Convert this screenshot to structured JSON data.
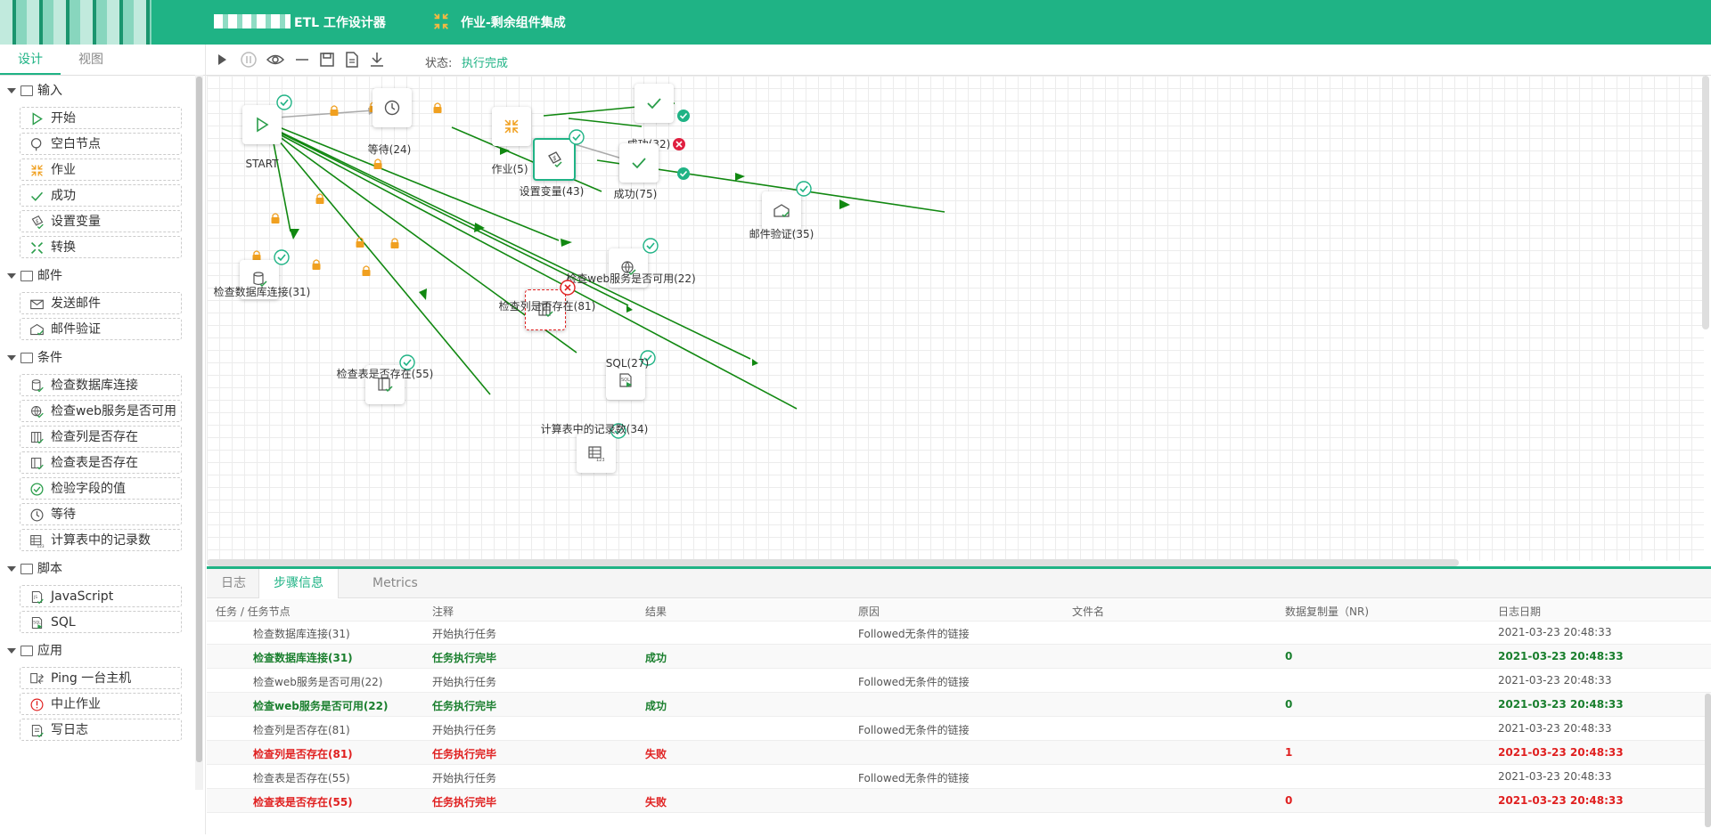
{
  "header": {
    "app_title": "ETL 工作设计器",
    "job_title": "作业-剩余组件集成"
  },
  "left": {
    "tabs": [
      "设计",
      "视图"
    ],
    "groups": [
      {
        "label": "输入",
        "items": [
          {
            "label": "开始",
            "icon": "play-icon"
          },
          {
            "label": "空白节点",
            "icon": "blank-node-icon"
          },
          {
            "label": "作业",
            "icon": "job-icon"
          },
          {
            "label": "成功",
            "icon": "check-icon"
          },
          {
            "label": "设置变量",
            "icon": "set-variable-icon"
          },
          {
            "label": "转换",
            "icon": "transform-icon"
          }
        ]
      },
      {
        "label": "邮件",
        "items": [
          {
            "label": "发送邮件",
            "icon": "mail-icon"
          },
          {
            "label": "邮件验证",
            "icon": "mail-verify-icon"
          }
        ]
      },
      {
        "label": "条件",
        "items": [
          {
            "label": "检查数据库连接",
            "icon": "database-icon"
          },
          {
            "label": "检查web服务是否可用",
            "icon": "web-service-icon"
          },
          {
            "label": "检查列是否存在",
            "icon": "column-icon"
          },
          {
            "label": "检查表是否存在",
            "icon": "table-icon"
          },
          {
            "label": "检验字段的值",
            "icon": "check-circle-icon"
          },
          {
            "label": "等待",
            "icon": "clock-icon"
          },
          {
            "label": "计算表中的记录数",
            "icon": "count-icon"
          }
        ]
      },
      {
        "label": "脚本",
        "items": [
          {
            "label": "JavaScript",
            "icon": "script-icon"
          },
          {
            "label": "SQL",
            "icon": "sql-icon"
          }
        ]
      },
      {
        "label": "应用",
        "items": [
          {
            "label": "Ping 一台主机",
            "icon": "ping-icon"
          },
          {
            "label": "中止作业",
            "icon": "abort-icon"
          },
          {
            "label": "写日志",
            "icon": "log-icon"
          }
        ]
      }
    ]
  },
  "toolbar": {
    "status_label": "状态:",
    "status_value": "执行完成"
  },
  "canvas": {
    "nodes": [
      {
        "id": "start",
        "label": "START",
        "icon": "play-icon",
        "state": "ok"
      },
      {
        "id": "wait",
        "label": "等待(24)",
        "icon": "clock-icon",
        "state": "none"
      },
      {
        "id": "job",
        "label": "作业(5)",
        "icon": "job-icon",
        "state": "none"
      },
      {
        "id": "succ32",
        "label": "成功(32)",
        "icon": "check-icon",
        "state": "none"
      },
      {
        "id": "succ75",
        "label": "成功(75)",
        "icon": "check-icon",
        "state": "none"
      },
      {
        "id": "setvar",
        "label": "设置变量(43)",
        "icon": "set-variable-icon",
        "state": "ok"
      },
      {
        "id": "mail",
        "label": "邮件验证(35)",
        "icon": "mail-verify-icon",
        "state": "ok"
      },
      {
        "id": "web",
        "label": "检查web服务是否可用(22)",
        "icon": "web-service-icon",
        "state": "ok"
      },
      {
        "id": "db",
        "label": "检查数据库连接(31)",
        "icon": "database-icon",
        "state": "ok"
      },
      {
        "id": "col",
        "label": "检查列是否存在(81)",
        "icon": "column-icon",
        "state": "fail"
      },
      {
        "id": "sql",
        "label": "SQL(27)",
        "icon": "sql-icon",
        "state": "ok"
      },
      {
        "id": "tbl",
        "label": "检查表是否存在(55)",
        "icon": "table-icon",
        "state": "ok"
      },
      {
        "id": "cnt",
        "label": "计算表中的记录数(34)",
        "icon": "count-icon",
        "state": "ok"
      }
    ]
  },
  "bottom": {
    "tabs": [
      "日志",
      "步骤信息",
      "Metrics"
    ],
    "columns": [
      "任务 / 任务节点",
      "注释",
      "结果",
      "原因",
      "文件名",
      "数据复制量（NR)",
      "日志日期"
    ],
    "rows": [
      {
        "style": "plain",
        "node": "检查数据库连接(31)",
        "note": "开始执行任务",
        "result": "",
        "reason": "Followed无条件的链接",
        "file": "",
        "nr": "",
        "date": "2021-03-23 20:48:33"
      },
      {
        "style": "ok",
        "node": "检查数据库连接(31)",
        "note": "任务执行完毕",
        "result": "成功",
        "reason": "",
        "file": "",
        "nr": "0",
        "date": "2021-03-23 20:48:33"
      },
      {
        "style": "plain",
        "node": "检查web服务是否可用(22)",
        "note": "开始执行任务",
        "result": "",
        "reason": "Followed无条件的链接",
        "file": "",
        "nr": "",
        "date": "2021-03-23 20:48:33"
      },
      {
        "style": "ok",
        "node": "检查web服务是否可用(22)",
        "note": "任务执行完毕",
        "result": "成功",
        "reason": "",
        "file": "",
        "nr": "0",
        "date": "2021-03-23 20:48:33"
      },
      {
        "style": "plain",
        "node": "检查列是否存在(81)",
        "note": "开始执行任务",
        "result": "",
        "reason": "Followed无条件的链接",
        "file": "",
        "nr": "",
        "date": "2021-03-23 20:48:33"
      },
      {
        "style": "fail",
        "node": "检查列是否存在(81)",
        "note": "任务执行完毕",
        "result": "失败",
        "reason": "",
        "file": "",
        "nr": "1",
        "date": "2021-03-23 20:48:33"
      },
      {
        "style": "plain",
        "node": "检查表是否存在(55)",
        "note": "开始执行任务",
        "result": "",
        "reason": "Followed无条件的链接",
        "file": "",
        "nr": "",
        "date": "2021-03-23 20:48:33"
      },
      {
        "style": "fail",
        "node": "检查表是否存在(55)",
        "note": "任务执行完毕",
        "result": "失败",
        "reason": "",
        "file": "",
        "nr": "0",
        "date": "2021-03-23 20:48:33"
      }
    ]
  },
  "colors": {
    "brand": "#1fb385",
    "success": "#1a7f2e",
    "failure": "#e02020",
    "lock": "#f0a020"
  }
}
